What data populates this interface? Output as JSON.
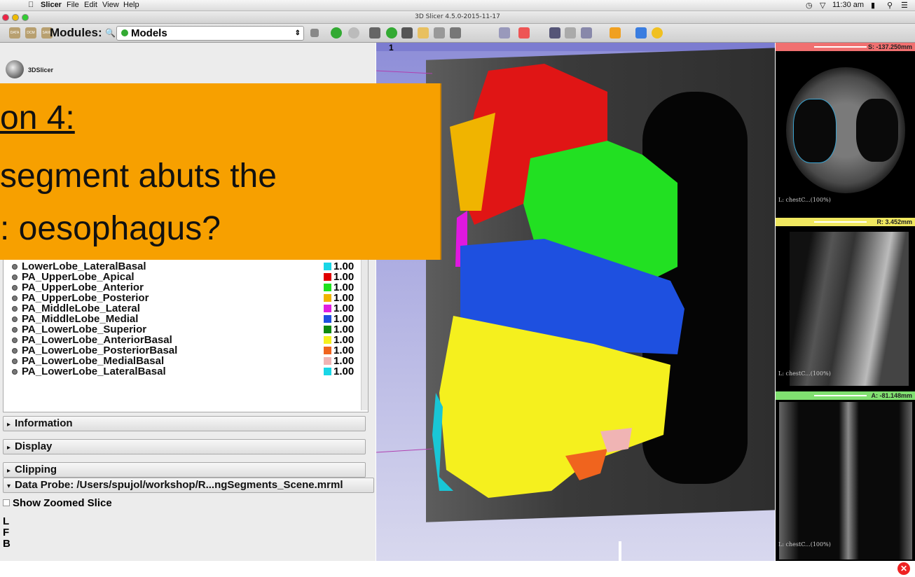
{
  "menubar": {
    "apple": "",
    "app": "Slicer",
    "items": [
      "File",
      "Edit",
      "View",
      "Help"
    ],
    "clock": "11:30 am"
  },
  "window": {
    "title": "3D Slicer 4.5.0-2015-11-17"
  },
  "toolbar": {
    "modules_label": "Modules:",
    "module": "Models",
    "data_btn": "DATA",
    "dcm_btn": "DCM",
    "save_btn": "SAVE"
  },
  "logo_text": "3DSlicer",
  "overlay": {
    "line1": "on 4:",
    "line2": " segment abuts the",
    " line3": "",
    "line3b": ": oesophagus?"
  },
  "models": [
    {
      "name": "LowerLobe_LateralBasal",
      "color": "#19d6e6",
      "opacity": "1.00"
    },
    {
      "name": "PA_UpperLobe_Apical",
      "color": "#e00000",
      "opacity": "1.00"
    },
    {
      "name": "PA_UpperLobe_Anterior",
      "color": "#1ee21e",
      "opacity": "1.00"
    },
    {
      "name": "PA_UpperLobe_Posterior",
      "color": "#f0b400",
      "opacity": "1.00"
    },
    {
      "name": "PA_MiddleLobe_Lateral",
      "color": "#e01ee0",
      "opacity": "1.00"
    },
    {
      "name": "PA_MiddleLobe_Medial",
      "color": "#1e50e0",
      "opacity": "1.00"
    },
    {
      "name": "PA_LowerLobe_Superior",
      "color": "#0f8a0f",
      "opacity": "1.00"
    },
    {
      "name": "PA_LowerLobe_AnteriorBasal",
      "color": "#f5f01e",
      "opacity": "1.00"
    },
    {
      "name": "PA_LowerLobe_PosteriorBasal",
      "color": "#f0641e",
      "opacity": "1.00"
    },
    {
      "name": "PA_LowerLobe_MedialBasal",
      "color": "#f0b4b4",
      "opacity": "1.00"
    },
    {
      "name": "PA_LowerLobe_LateralBasal",
      "color": "#19d6e6",
      "opacity": "1.00"
    }
  ],
  "sections": [
    "Information",
    "Display",
    "Clipping"
  ],
  "data_probe": {
    "title": "Data Probe: /Users/spujol/workshop/R...ngSegments_Scene.mrml",
    "show_zoomed": "Show Zoomed Slice",
    "l": "L",
    "f": "F",
    "b": "B"
  },
  "view3d": {
    "label": "1"
  },
  "slices": [
    {
      "name": "red",
      "offset": "S: -137.250mm",
      "footer": "L: chestC...(100%)",
      "bar_color": "#f07070"
    },
    {
      "name": "yellow",
      "offset": "R: 3.452mm",
      "footer": "L: chestC...(100%)",
      "bar_color": "#f0e860"
    },
    {
      "name": "green",
      "offset": "A: -81.148mm",
      "footer": "L: chestC...(100%)",
      "bar_color": "#80e070"
    }
  ]
}
